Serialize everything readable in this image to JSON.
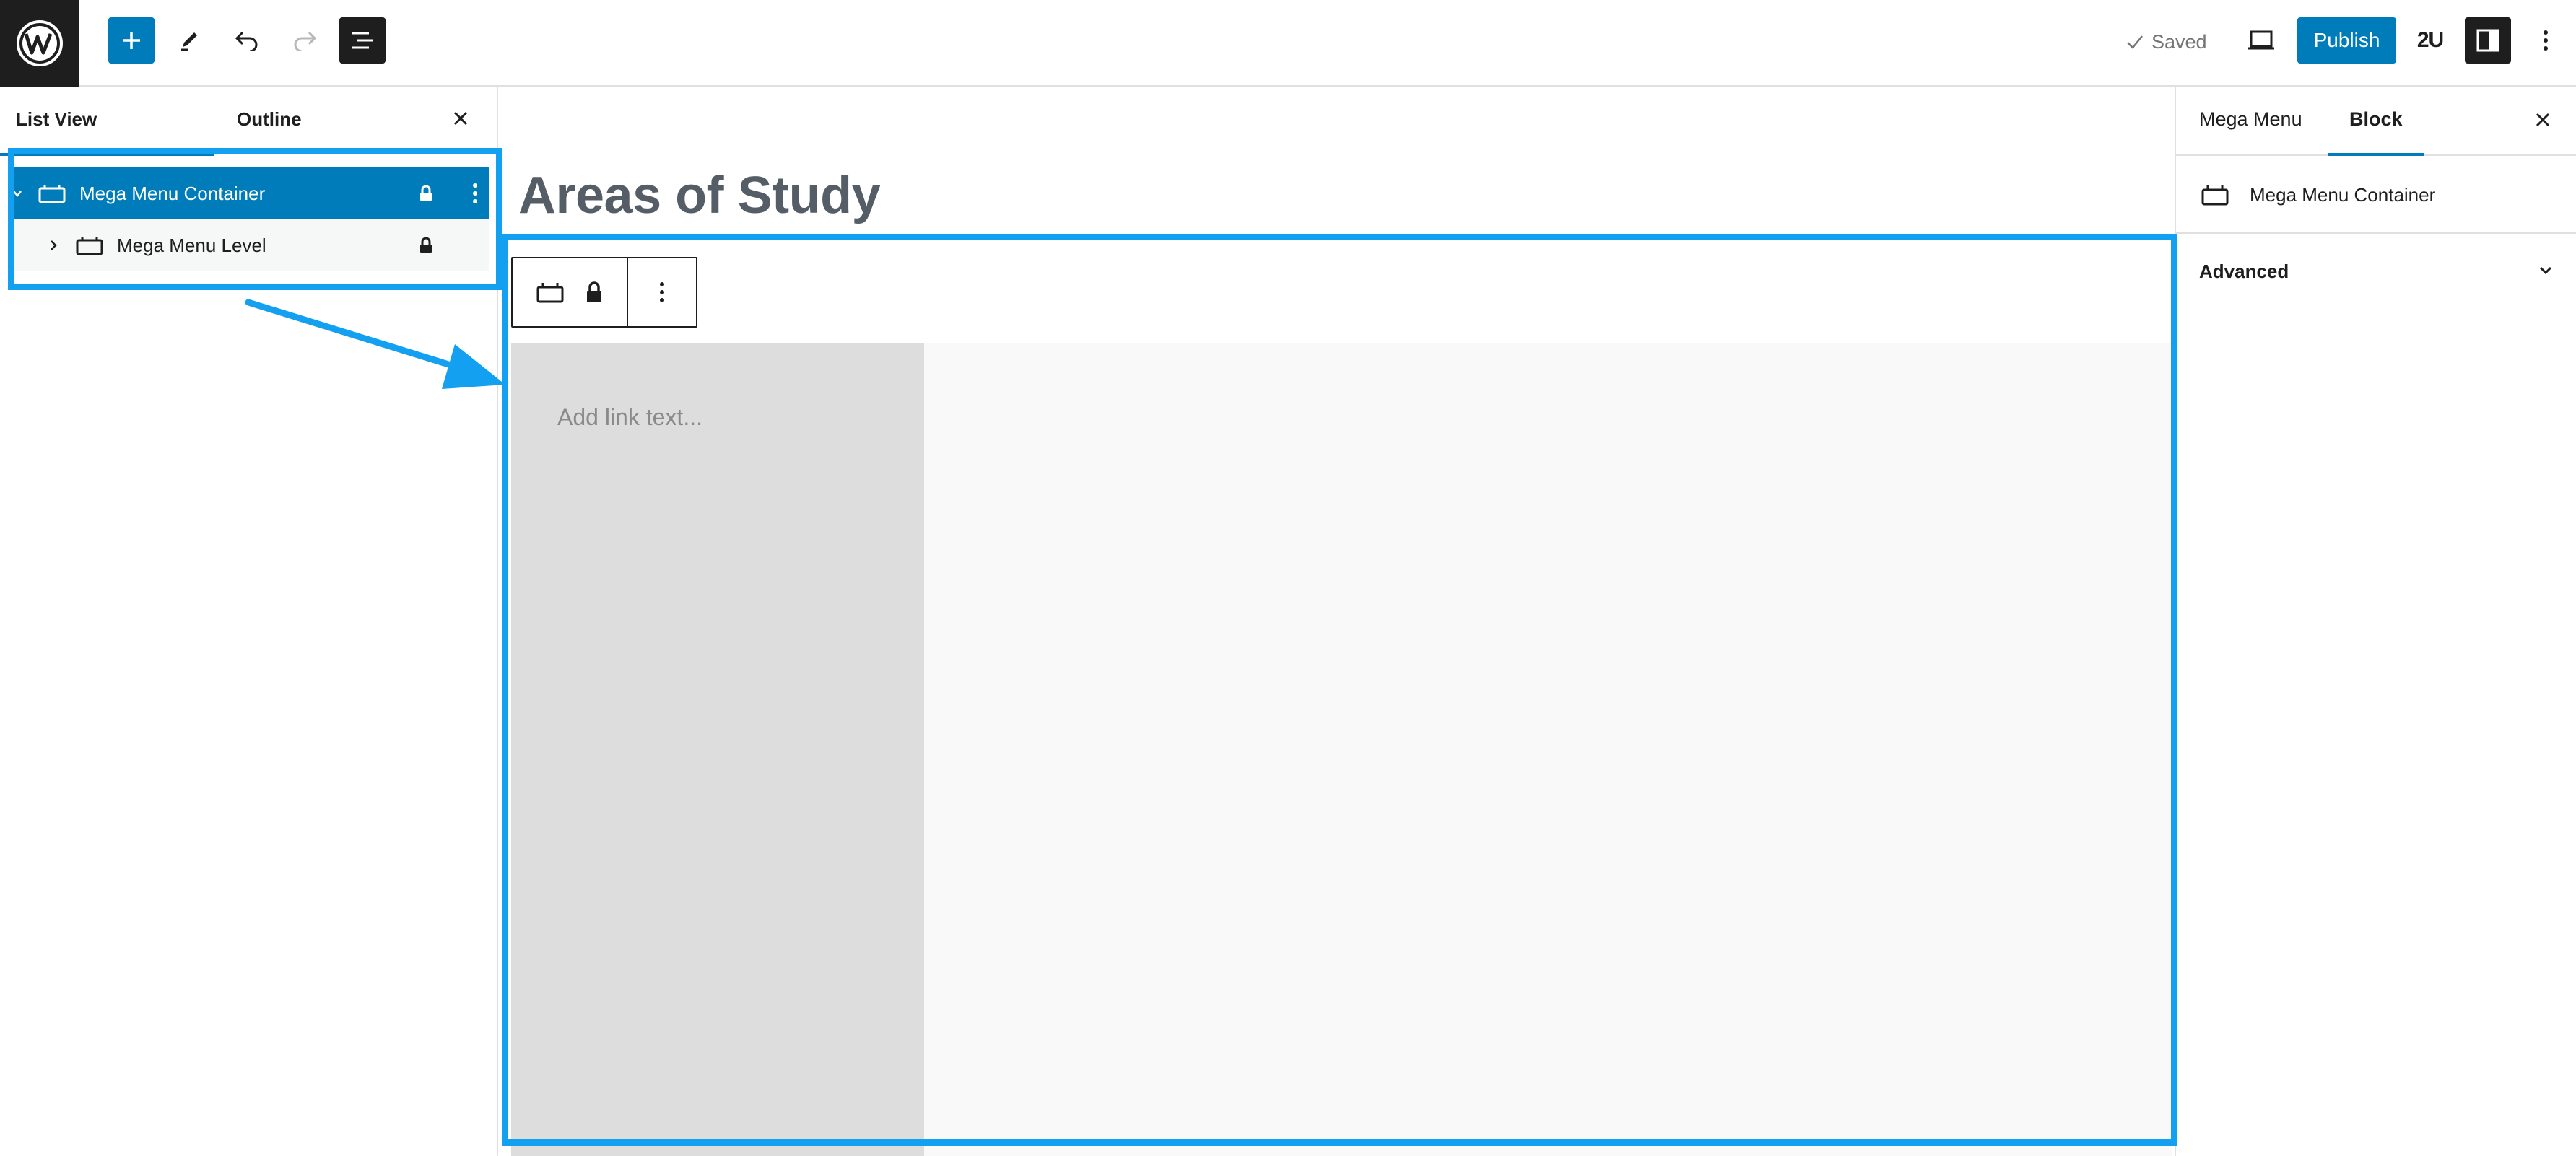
{
  "toolbar": {
    "add_block": "plus-icon",
    "tools": "pencil-icon",
    "undo": "undo-icon",
    "redo": "redo-icon",
    "document_overview": "list-view-icon",
    "saved_label": "Saved",
    "publish_label": "Publish",
    "plugin_label": "2U"
  },
  "list_panel": {
    "tabs": [
      {
        "label": "List View",
        "active": true
      },
      {
        "label": "Outline",
        "active": false
      }
    ],
    "rows": [
      {
        "label": "Mega Menu Container",
        "selected": true,
        "locked": true
      },
      {
        "label": "Mega Menu Level",
        "selected": false,
        "locked": true
      }
    ]
  },
  "canvas": {
    "page_title": "Areas of Study",
    "link_placeholder": "Add link text..."
  },
  "sidebar": {
    "tabs": [
      {
        "label": "Mega Menu",
        "active": false
      },
      {
        "label": "Block",
        "active": true
      }
    ],
    "block_card_title": "Mega Menu Container",
    "panels": [
      {
        "title": "Advanced",
        "open": false
      }
    ]
  },
  "colors": {
    "accent": "#007cba",
    "annotation": "#13a0f0",
    "dark": "#1e1e1e"
  }
}
